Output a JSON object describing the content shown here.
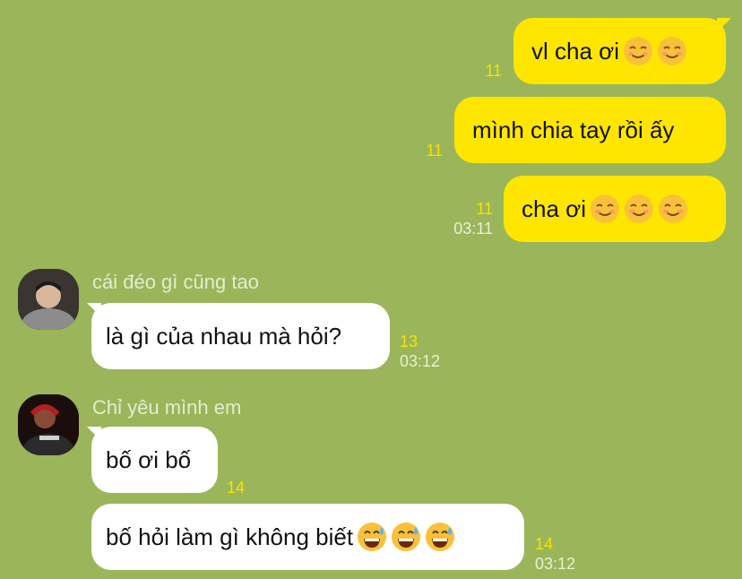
{
  "outgoing": [
    {
      "text": "vl cha ơi",
      "emoji": [
        "smile",
        "smile"
      ],
      "count": "11",
      "time": ""
    },
    {
      "text": "mình chia tay rồi ấy",
      "emoji": [],
      "count": "11",
      "time": ""
    },
    {
      "text": "cha ơi",
      "emoji": [
        "smile",
        "smile",
        "smile"
      ],
      "count": "11",
      "time": "03:11"
    }
  ],
  "incoming": [
    {
      "sender": "cái đéo gì cũng tao",
      "messages": [
        {
          "text": "là gì của nhau mà hỏi?",
          "emoji": [],
          "count": "13",
          "time": "03:12"
        }
      ]
    },
    {
      "sender": "Chỉ yêu mình em",
      "messages": [
        {
          "text": "bố ơi bố",
          "emoji": [],
          "count": "14",
          "time": ""
        },
        {
          "text": "bố hỏi làm gì không biết",
          "emoji": [
            "sweat",
            "sweat",
            "sweat"
          ],
          "count": "14",
          "time": "03:12"
        }
      ]
    }
  ],
  "icons": {
    "smile": "relieved-smile-emoji",
    "sweat": "grinning-sweat-emoji"
  },
  "colors": {
    "background": "#9bb55a",
    "outgoing_bubble": "#ffe600",
    "incoming_bubble": "#ffffff",
    "unread_count": "#f7e300"
  }
}
